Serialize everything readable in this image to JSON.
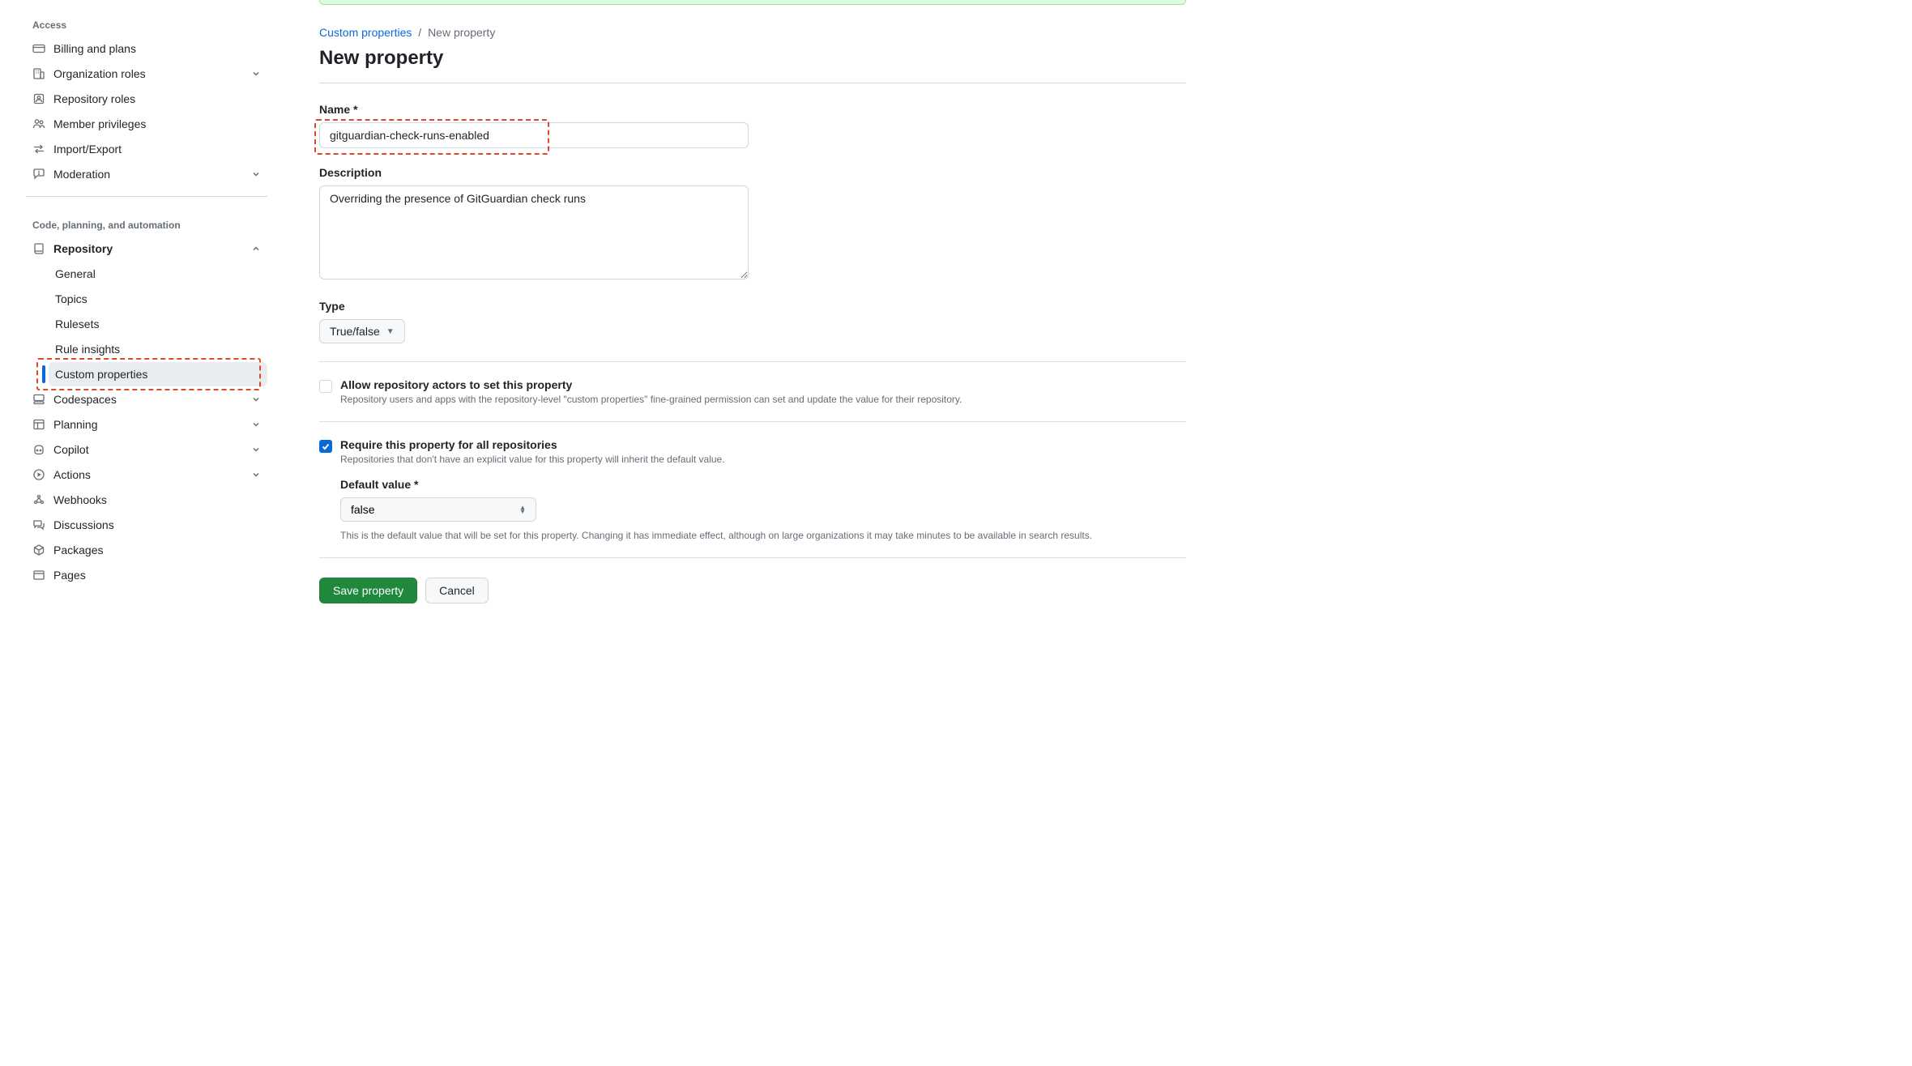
{
  "sidebar": {
    "groups": [
      {
        "title": "Access",
        "items": [
          {
            "label": "Billing and plans"
          },
          {
            "label": "Organization roles"
          },
          {
            "label": "Repository roles"
          },
          {
            "label": "Member privileges"
          },
          {
            "label": "Import/Export"
          },
          {
            "label": "Moderation"
          }
        ]
      },
      {
        "title": "Code, planning, and automation",
        "items": [
          {
            "label": "Repository"
          },
          {
            "label": "Codespaces"
          },
          {
            "label": "Planning"
          },
          {
            "label": "Copilot"
          },
          {
            "label": "Actions"
          },
          {
            "label": "Webhooks"
          },
          {
            "label": "Discussions"
          },
          {
            "label": "Packages"
          },
          {
            "label": "Pages"
          }
        ],
        "repository_sub": [
          {
            "label": "General"
          },
          {
            "label": "Topics"
          },
          {
            "label": "Rulesets"
          },
          {
            "label": "Rule insights"
          },
          {
            "label": "Custom properties"
          }
        ]
      }
    ]
  },
  "breadcrumb": {
    "parent": "Custom properties",
    "current": "New property"
  },
  "page_title": "New property",
  "form": {
    "name_label": "Name *",
    "name_value": "gitguardian-check-runs-enabled",
    "description_label": "Description",
    "description_value": "Overriding the presence of GitGuardian check runs",
    "type_label": "Type",
    "type_value": "True/false",
    "allow_actors": {
      "title": "Allow repository actors to set this property",
      "desc": "Repository users and apps with the repository-level \"custom properties\" fine-grained permission can set and update the value for their repository.",
      "checked": false
    },
    "require_property": {
      "title": "Require this property for all repositories",
      "desc": "Repositories that don't have an explicit value for this property will inherit the default value.",
      "checked": true
    },
    "default_value_label": "Default value *",
    "default_value": "false",
    "default_value_note": "This is the default value that will be set for this property. Changing it has immediate effect, although on large organizations it may take minutes to be available in search results."
  },
  "buttons": {
    "save": "Save property",
    "cancel": "Cancel"
  }
}
